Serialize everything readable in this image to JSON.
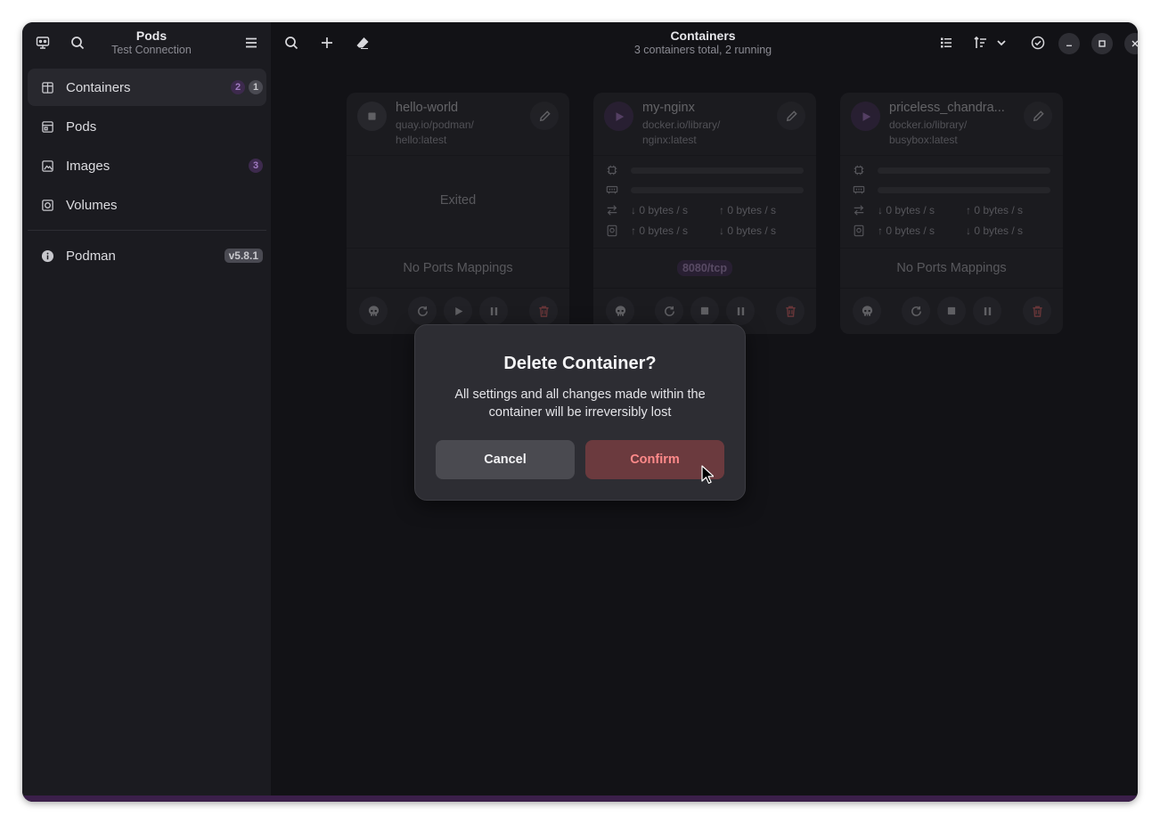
{
  "sidebar": {
    "title": "Pods",
    "subtitle": "Test Connection",
    "items": [
      {
        "label": "Containers",
        "icon": "containers-icon",
        "badges": [
          "2",
          "1"
        ]
      },
      {
        "label": "Pods",
        "icon": "pods-icon",
        "badges": []
      },
      {
        "label": "Images",
        "icon": "images-icon",
        "badges": [
          "3"
        ]
      },
      {
        "label": "Volumes",
        "icon": "volumes-icon",
        "badges": []
      }
    ],
    "engine": {
      "label": "Podman",
      "icon": "info-icon",
      "version": "v5.8.1"
    }
  },
  "header": {
    "title": "Containers",
    "subtitle": "3 containers total, 2 running"
  },
  "containers": [
    {
      "name": "hello-world",
      "image_line1": "quay.io/podman/",
      "image_line2": "hello:latest",
      "state": "Exited",
      "ports": "No Ports Mappings"
    },
    {
      "name": "my-nginx",
      "image_line1": "docker.io/library/",
      "image_line2": "nginx:latest",
      "net_down": "↓ 0 bytes / s",
      "net_up": "↑ 0 bytes / s",
      "disk_up": "↑ 0 bytes / s",
      "disk_down": "↓ 0 bytes / s",
      "ports": "8080/tcp"
    },
    {
      "name": "priceless_chandra...",
      "image_line1": "docker.io/library/",
      "image_line2": "busybox:latest",
      "net_down": "↓ 0 bytes / s",
      "net_up": "↑ 0 bytes / s",
      "disk_up": "↑ 0 bytes / s",
      "disk_down": "↓ 0 bytes / s",
      "ports": "No Ports Mappings"
    }
  ],
  "dialog": {
    "title": "Delete Container?",
    "body": "All settings and all changes made within the container will be irreversibly lost",
    "cancel_label": "Cancel",
    "confirm_label": "Confirm"
  },
  "colors": {
    "accent_purple": "#a07ac0",
    "destructive": "#ff8a8a",
    "background": "#121216"
  }
}
